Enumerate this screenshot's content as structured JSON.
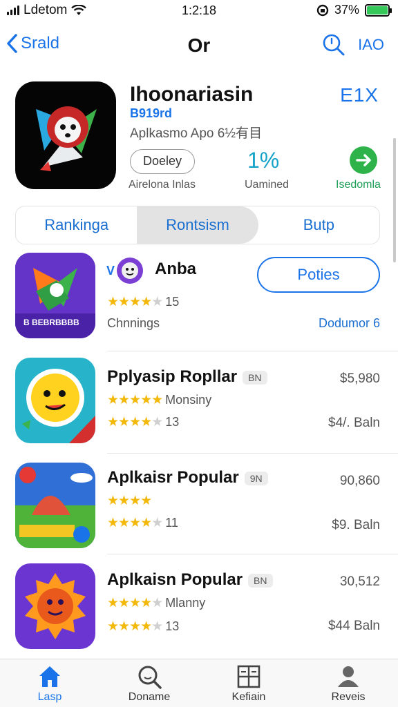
{
  "status_bar": {
    "carrier": "Ldetom",
    "time": "1:2:18",
    "battery": "37%"
  },
  "nav": {
    "back_label": "Srald",
    "title": "Or",
    "right_label": "IAO"
  },
  "featured": {
    "name": "Ihoonariasin",
    "badge": "B919rd",
    "subtitle": "Aplkasmo Apo 6½有目",
    "ext_label": "E1X",
    "button_label": "Doeley",
    "button_caption": "Airelona Inlas",
    "percent": "1%",
    "percent_caption": "Uamined",
    "go_caption": "Isedomla"
  },
  "segments": [
    {
      "label": "Rankinga",
      "active": false
    },
    {
      "label": "Rontsism",
      "active": true
    },
    {
      "label": "Butp",
      "active": false
    }
  ],
  "list": [
    {
      "name": "Anba",
      "rating": "15",
      "stars_value": 4,
      "note": "Chnnings",
      "pill_label": "Poties",
      "link_label": "Dodumor 6",
      "icon_caption": "B BEBRBBBB"
    },
    {
      "name": "Pplyasip Ropllar",
      "tag": "BN",
      "note": "Monsiny",
      "stars_value": 4,
      "rating": "13",
      "price": "$5,980",
      "sub_price": "$4/. Baln"
    },
    {
      "name": "Aplkaisr Popular",
      "tag": "9N",
      "stars_value": 4,
      "rating": "11",
      "price": "90,860",
      "sub_price": "$9. Baln"
    },
    {
      "name": "Aplkaisn Popular",
      "tag": "BN",
      "note": "Mlanny",
      "stars_value": 4,
      "rating": "13",
      "price": "30,512",
      "sub_price": "$44 Baln"
    }
  ],
  "tabs": [
    {
      "label": "Lasp",
      "icon": "home-icon",
      "active": true
    },
    {
      "label": "Doname",
      "icon": "search-icon",
      "active": false
    },
    {
      "label": "Kefiain",
      "icon": "grid-icon",
      "active": false
    },
    {
      "label": "Reveis",
      "icon": "person-icon",
      "active": false
    }
  ],
  "colors": {
    "accent": "#1a73e8",
    "star": "#f2b80a",
    "go": "#2eb34a",
    "battery": "#34c759"
  }
}
